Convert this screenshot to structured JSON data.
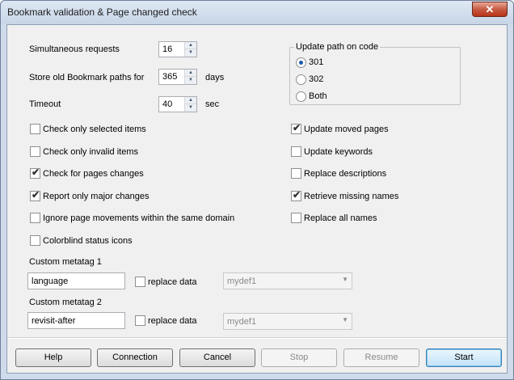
{
  "window": {
    "title": "Bookmark validation & Page changed check",
    "close_label": "✕"
  },
  "settings": {
    "simultaneous": {
      "label": "Simultaneous requests",
      "value": "16"
    },
    "store_old": {
      "label": "Store old Bookmark paths for",
      "value": "365",
      "unit": "days"
    },
    "timeout": {
      "label": "Timeout",
      "value": "40",
      "unit": "sec"
    }
  },
  "update_path": {
    "legend": "Update path on code",
    "options": [
      {
        "label": "301",
        "selected": true
      },
      {
        "label": "302",
        "selected": false
      },
      {
        "label": "Both",
        "selected": false
      }
    ]
  },
  "left_checks": [
    {
      "label": "Check only selected items",
      "checked": false
    },
    {
      "label": "Check only invalid items",
      "checked": false
    },
    {
      "label": "Check for pages changes",
      "checked": true
    },
    {
      "label": "Report only major changes",
      "checked": true
    },
    {
      "label": "Ignore page movements within the same domain",
      "checked": false
    },
    {
      "label": "Colorblind status icons",
      "checked": false
    }
  ],
  "right_checks": [
    {
      "label": "Update moved pages",
      "checked": true
    },
    {
      "label": "Update keywords",
      "checked": false
    },
    {
      "label": "Replace descriptions",
      "checked": false
    },
    {
      "label": "Retrieve missing names",
      "checked": true
    },
    {
      "label": "Replace all names",
      "checked": false
    }
  ],
  "metatag1": {
    "label": "Custom metatag 1",
    "value": "language",
    "replace_label": "replace data",
    "replace_checked": false,
    "combo_value": "mydef1"
  },
  "metatag2": {
    "label": "Custom metatag 2",
    "value": "revisit-after",
    "replace_label": "replace data",
    "replace_checked": false,
    "combo_value": "mydef1"
  },
  "buttons": {
    "help": "Help",
    "connection": "Connection",
    "cancel": "Cancel",
    "stop": "Stop",
    "resume": "Resume",
    "start": "Start"
  },
  "icons": {
    "check": "✔",
    "spin_up": "▲",
    "spin_down": "▼",
    "dropdown": "▼"
  }
}
